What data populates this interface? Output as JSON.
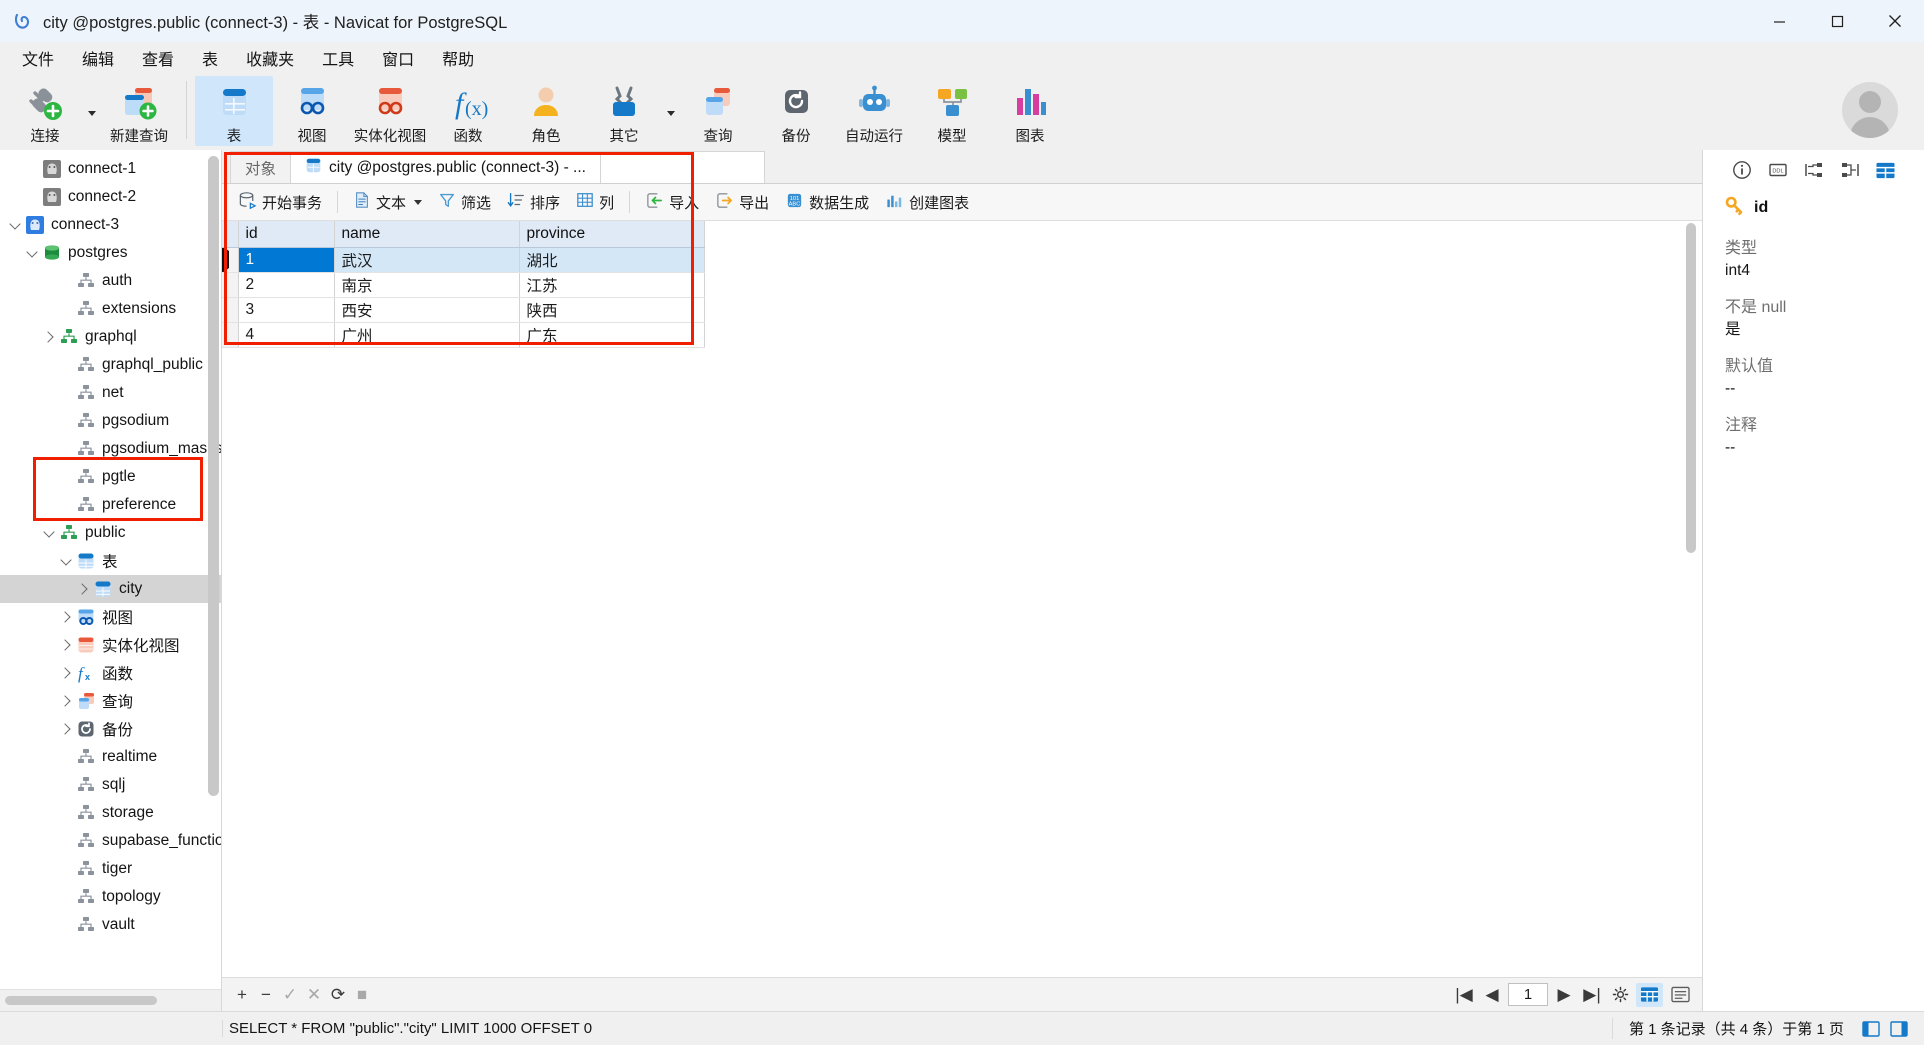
{
  "window": {
    "title": "city @postgres.public (connect-3) - 表 - Navicat for PostgreSQL",
    "minimize": "—",
    "maximize": "▢",
    "close": "✕"
  },
  "menubar": {
    "items": [
      "文件",
      "编辑",
      "查看",
      "表",
      "收藏夹",
      "工具",
      "窗口",
      "帮助"
    ]
  },
  "toolbar": {
    "groups": [
      [
        {
          "label": "连接",
          "icon": "new-connection-icon",
          "caret": true
        },
        {
          "label": "新建查询",
          "icon": "new-query-icon",
          "caret": false
        }
      ],
      [
        {
          "label": "表",
          "icon": "table-icon",
          "caret": false,
          "active": true
        },
        {
          "label": "视图",
          "icon": "view-icon",
          "caret": false
        },
        {
          "label": "实体化视图",
          "icon": "materialized-view-icon",
          "caret": false
        },
        {
          "label": "函数",
          "icon": "function-icon",
          "caret": false
        },
        {
          "label": "角色",
          "icon": "role-icon",
          "caret": false
        },
        {
          "label": "其它",
          "icon": "other-icon",
          "caret": true
        },
        {
          "label": "查询",
          "icon": "query-icon",
          "caret": false
        },
        {
          "label": "备份",
          "icon": "backup-icon",
          "caret": false
        },
        {
          "label": "自动运行",
          "icon": "automation-icon",
          "caret": false
        },
        {
          "label": "模型",
          "icon": "model-icon",
          "caret": false
        },
        {
          "label": "图表",
          "icon": "chart-icon",
          "caret": false
        }
      ]
    ]
  },
  "sidebar": {
    "nodes": [
      {
        "label": "connect-1",
        "indent": 1,
        "icon": "postgres-conn-icon",
        "twisty": "none",
        "state": "offline"
      },
      {
        "label": "connect-2",
        "indent": 1,
        "icon": "postgres-conn-icon",
        "twisty": "none",
        "state": "offline"
      },
      {
        "label": "connect-3",
        "indent": 0,
        "icon": "postgres-conn-icon",
        "twisty": "down",
        "state": "online"
      },
      {
        "label": "postgres",
        "indent": 1,
        "icon": "database-icon",
        "twisty": "down"
      },
      {
        "label": "auth",
        "indent": 3,
        "icon": "schema-icon",
        "twisty": "none"
      },
      {
        "label": "extensions",
        "indent": 3,
        "icon": "schema-icon",
        "twisty": "none"
      },
      {
        "label": "graphql",
        "indent": 2,
        "icon": "schema-active-icon",
        "twisty": "right"
      },
      {
        "label": "graphql_public",
        "indent": 3,
        "icon": "schema-icon",
        "twisty": "none"
      },
      {
        "label": "net",
        "indent": 3,
        "icon": "schema-icon",
        "twisty": "none"
      },
      {
        "label": "pgsodium",
        "indent": 3,
        "icon": "schema-icon",
        "twisty": "none"
      },
      {
        "label": "pgsodium_masks",
        "indent": 3,
        "icon": "schema-icon",
        "twisty": "none"
      },
      {
        "label": "pgtle",
        "indent": 3,
        "icon": "schema-icon",
        "twisty": "none"
      },
      {
        "label": "preference",
        "indent": 3,
        "icon": "schema-icon",
        "twisty": "none"
      },
      {
        "label": "public",
        "indent": 2,
        "icon": "schema-active-icon",
        "twisty": "down"
      },
      {
        "label": "表",
        "indent": 3,
        "icon": "table-icon",
        "twisty": "down"
      },
      {
        "label": "city",
        "indent": 4,
        "icon": "table-icon",
        "twisty": "right",
        "selected": true
      },
      {
        "label": "视图",
        "indent": 3,
        "icon": "view-icon",
        "twisty": "right"
      },
      {
        "label": "实体化视图",
        "indent": 3,
        "icon": "materialized-view-icon",
        "twisty": "right"
      },
      {
        "label": "函数",
        "indent": 3,
        "icon": "function-icon",
        "twisty": "right"
      },
      {
        "label": "查询",
        "indent": 3,
        "icon": "query-icon",
        "twisty": "right"
      },
      {
        "label": "备份",
        "indent": 3,
        "icon": "backup-icon",
        "twisty": "right"
      },
      {
        "label": "realtime",
        "indent": 3,
        "icon": "schema-icon",
        "twisty": "none"
      },
      {
        "label": "sqlj",
        "indent": 3,
        "icon": "schema-icon",
        "twisty": "none"
      },
      {
        "label": "storage",
        "indent": 3,
        "icon": "schema-icon",
        "twisty": "none"
      },
      {
        "label": "supabase_functions",
        "indent": 3,
        "icon": "schema-icon",
        "twisty": "none"
      },
      {
        "label": "tiger",
        "indent": 3,
        "icon": "schema-icon",
        "twisty": "none"
      },
      {
        "label": "topology",
        "indent": 3,
        "icon": "schema-icon",
        "twisty": "none"
      },
      {
        "label": "vault",
        "indent": 3,
        "icon": "schema-icon",
        "twisty": "none"
      }
    ]
  },
  "tabs": {
    "object_tab": "对象",
    "active_tab": "city @postgres.public (connect-3) - ..."
  },
  "gridtools": {
    "begin_transaction": "开始事务",
    "text": "文本",
    "filter": "筛选",
    "sort": "排序",
    "columns": "列",
    "import": "导入",
    "export": "导出",
    "data_generation": "数据生成",
    "create_chart": "创建图表"
  },
  "table": {
    "columns": [
      "id",
      "name",
      "province"
    ],
    "rows": [
      {
        "id": "1",
        "name": "武汉",
        "province": "湖北",
        "selected": true
      },
      {
        "id": "2",
        "name": "南京",
        "province": "江苏",
        "selected": false
      },
      {
        "id": "3",
        "name": "西安",
        "province": "陕西",
        "selected": false
      },
      {
        "id": "4",
        "name": "广州",
        "province": "广东",
        "selected": false
      }
    ]
  },
  "gridfooter": {
    "add": "+",
    "remove": "−",
    "confirm": "✓",
    "cancel": "✕",
    "refresh": "⟳",
    "stop": "■",
    "first_page": "|◀",
    "prev_page": "◀",
    "page_value": "1",
    "next_page": "▶",
    "last_page": "▶|",
    "settings": "gear-icon",
    "grid_view": "grid-view-icon",
    "form_view": "form-view-icon"
  },
  "rightpanel": {
    "icons": [
      "info-icon",
      "ddl-icon",
      "relations-in-icon",
      "relations-out-icon",
      "structure-icon"
    ],
    "field_name": "id",
    "fields": [
      {
        "label": "类型",
        "value": "int4"
      },
      {
        "label": "不是 null",
        "value": "是"
      },
      {
        "label": "默认值",
        "value": "--"
      },
      {
        "label": "注释",
        "value": "--"
      }
    ]
  },
  "statusbar": {
    "sql": "SELECT * FROM \"public\".\"city\" LIMIT 1000 OFFSET 0",
    "record_info": "第 1 条记录（共 4 条）于第 1 页"
  },
  "colors": {
    "accent": "#0078d4",
    "highlight_box": "#f01f00",
    "title_bg": "#eef4fb",
    "header_bg": "#dfeaf6",
    "selection_bg": "#d4e7f7"
  }
}
